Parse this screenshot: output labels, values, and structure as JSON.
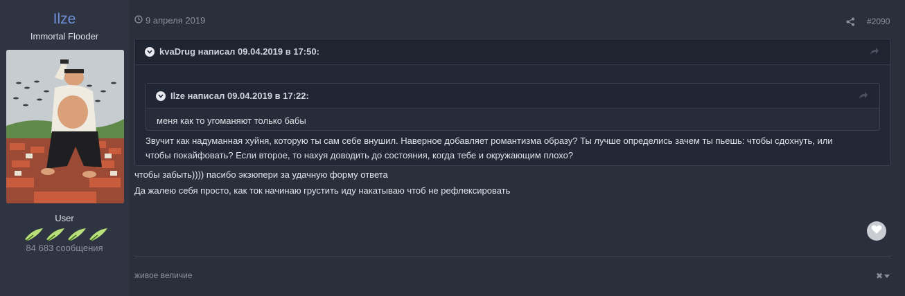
{
  "author": {
    "name": "Ilze",
    "title": "Immortal Flooder",
    "group": "User",
    "post_count": "84 683 сообщения"
  },
  "post": {
    "date": "9 апреля 2019",
    "number": "#2090",
    "outer_quote": {
      "header": "kvaDrug написал 09.04.2019 в 17:50:",
      "body_line1": "Звучит как надуманная хуйня, которую ты сам себе внушил. Наверное добавляет романтизма образу? Ты лучше определись зачем ты пьешь: чтобы сдохнуть, или",
      "body_line2": "чтобы покайфовать? Если второе, то нахуя доводить до состояния, когда тебе и окружающим плохо?"
    },
    "inner_quote": {
      "header": "Ilze написал 09.04.2019 в 17:22:",
      "body": "меня как то угоманяют только бабы"
    },
    "lines": [
      "чтобы забыть)))) пасибо экзюпери за удачную форму ответа",
      "Да жалею себя просто, как ток начинаю грустить иду накатываю чтоб не рефлексировать"
    ],
    "signature": "живое величие",
    "signature_toggle": "✖"
  },
  "colors": {
    "background": "#2a2f3b",
    "author_column": "#2e3442",
    "author_name": "#6f8fd6",
    "quote_bg": "#232836",
    "muted_text": "#8b919d"
  }
}
